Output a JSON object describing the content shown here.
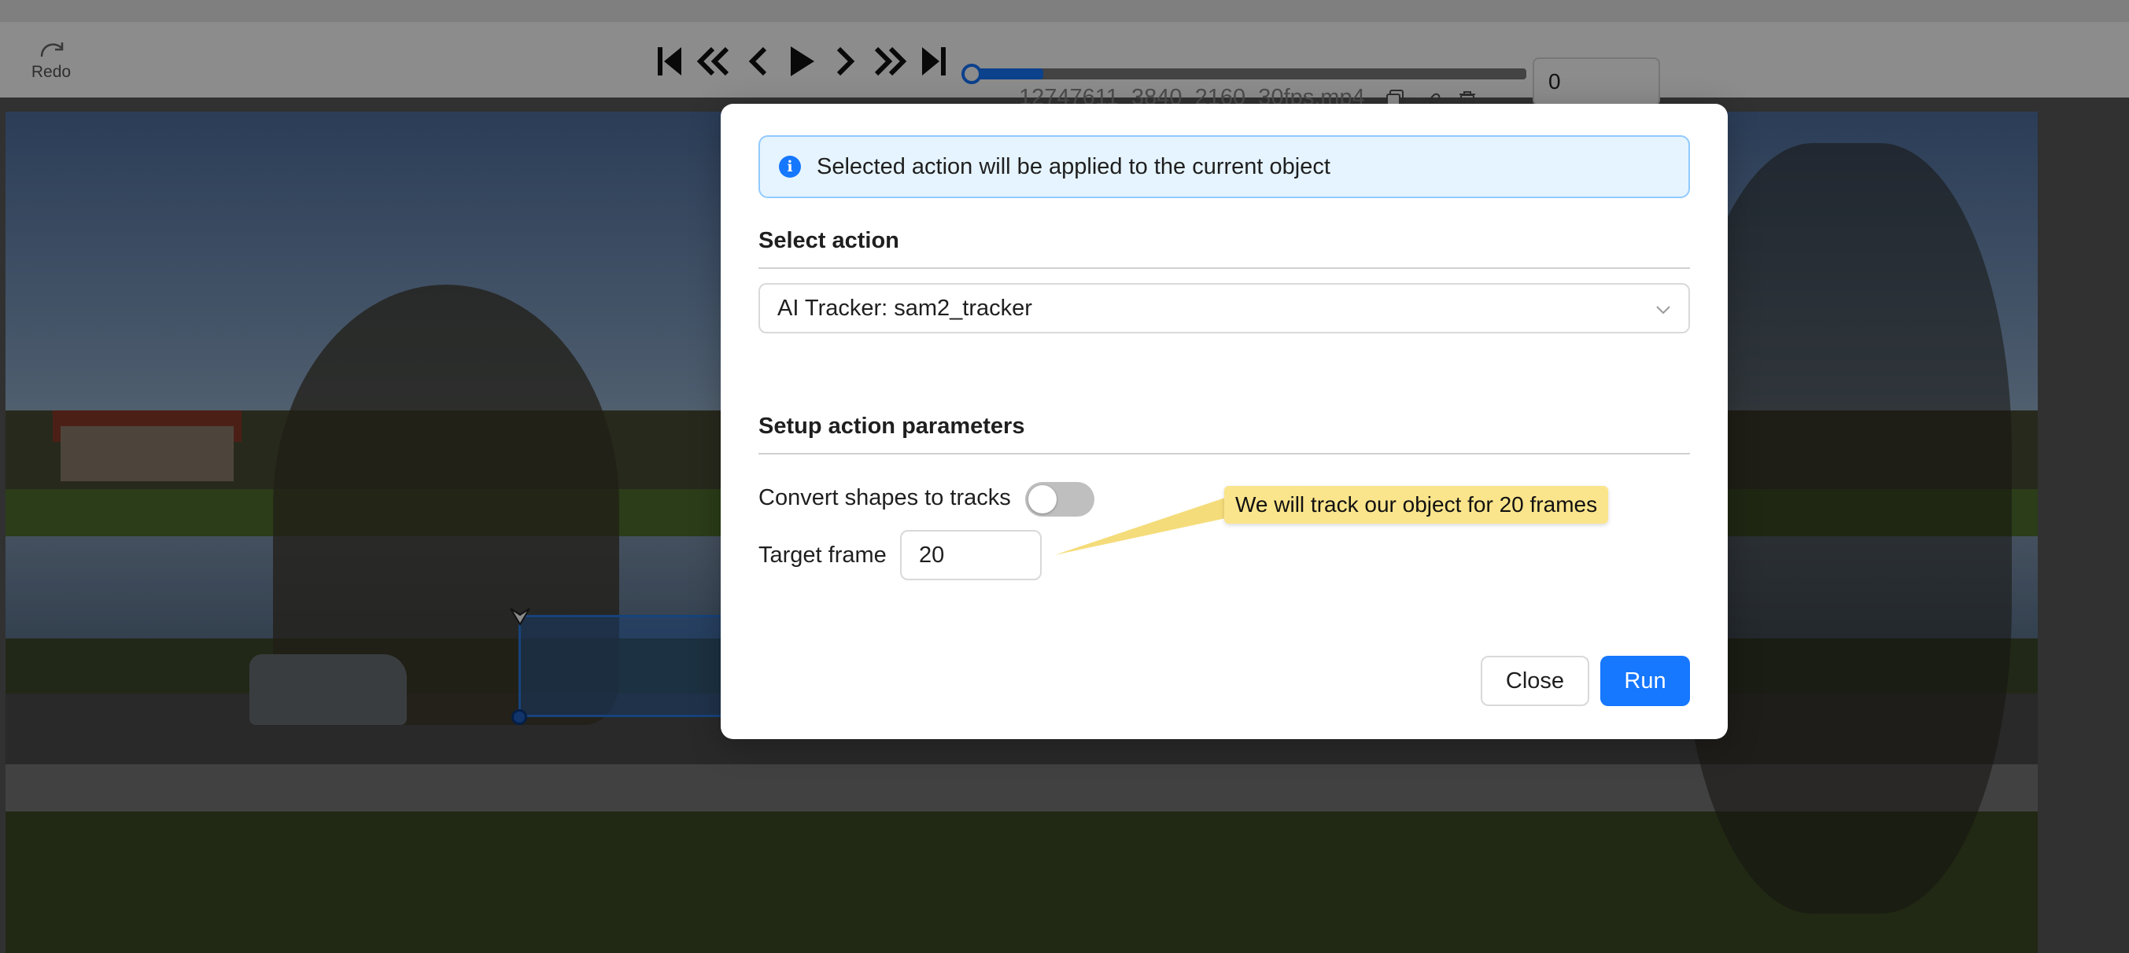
{
  "toolbar": {
    "redo_label": "Redo"
  },
  "player": {
    "filename": "12747611_3840_2160_30fps.mp4",
    "frame_value": "0",
    "progress_fraction": 0.13,
    "controls": [
      "first-frame-icon",
      "fast-backward-icon",
      "previous-frame-icon",
      "play-icon",
      "next-frame-icon",
      "fast-forward-icon",
      "last-frame-icon"
    ],
    "file_icons": [
      "copy-icon",
      "link-icon",
      "delete-icon"
    ]
  },
  "modal": {
    "alert_text": "Selected action will be applied to the current object",
    "select_action_title": "Select action",
    "selected_action": "AI Tracker: sam2_tracker",
    "setup_title": "Setup action parameters",
    "convert_label": "Convert shapes to tracks",
    "convert_enabled": false,
    "target_frame_label": "Target frame",
    "target_frame_value": "20",
    "close_label": "Close",
    "run_label": "Run",
    "accent_color": "#1677ff"
  },
  "annotation": {
    "callout_text": "We will track our object for 20 frames",
    "callout_color": "#fbe58c"
  }
}
